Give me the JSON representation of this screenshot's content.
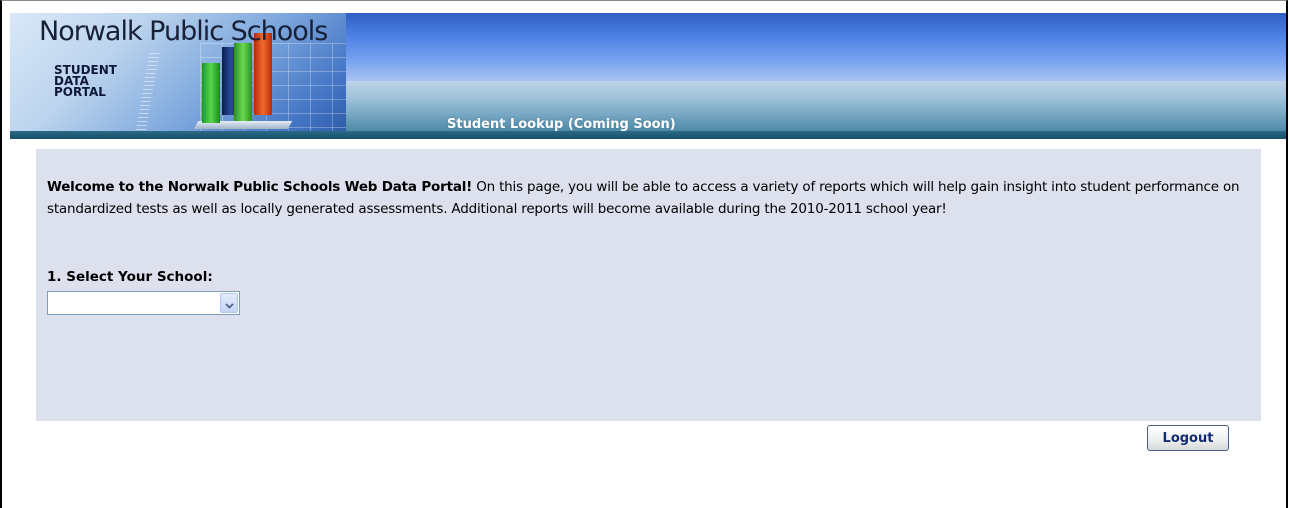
{
  "header": {
    "logo_title": "Norwalk Public Schools",
    "logo_subtitle_lines": [
      "STUDENT",
      "DATA",
      "PORTAL"
    ],
    "nav_tab_label": "Student Lookup (Coming Soon)"
  },
  "welcome": {
    "bold_intro": "Welcome to the Norwalk Public Schools Web Data Portal!",
    "body": " On this page, you will be able to access a variety of reports which will help gain insight into student performance on standardized tests as well as locally generated assessments. Additional reports will become available during the 2010-2011 school year!"
  },
  "school_selector": {
    "label": "1. Select Your School:",
    "selected_value": ""
  },
  "actions": {
    "logout_label": "Logout"
  },
  "icons": {
    "dropdown": "chevron-down-icon"
  },
  "colors": {
    "panel_background": "#dce1ed",
    "header_blue": "#4f82e6",
    "header_teal": "#4d8aa6",
    "logout_text": "#122a73"
  }
}
